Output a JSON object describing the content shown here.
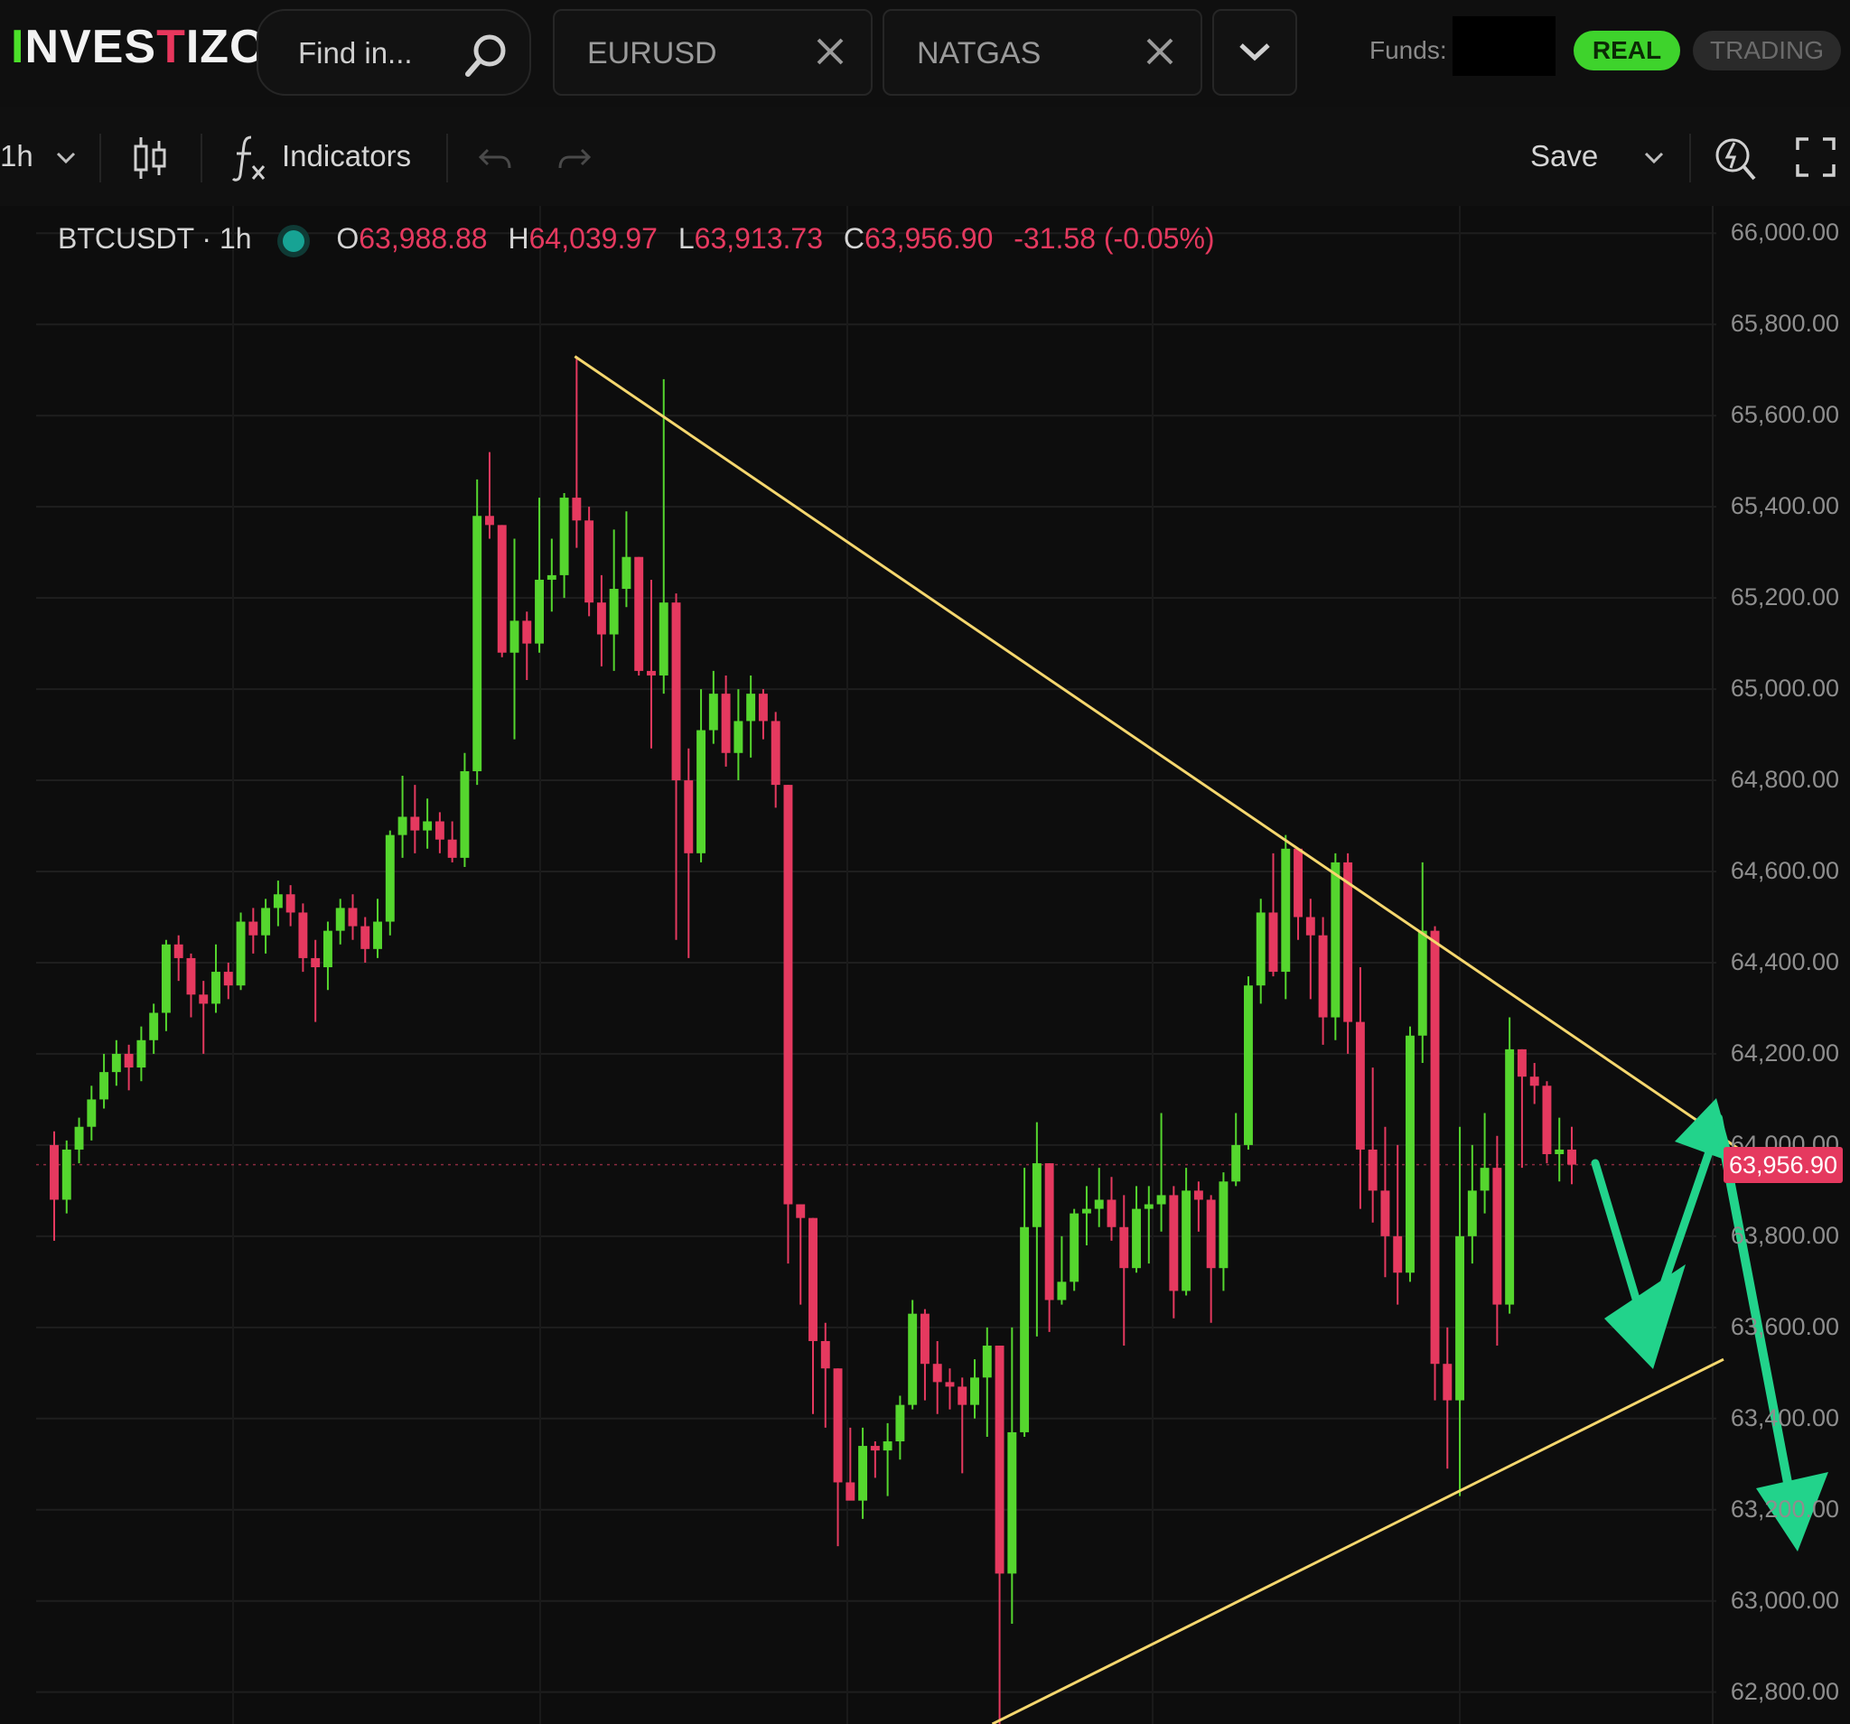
{
  "header": {
    "logo_text": "INVESTIZO",
    "search_placeholder": "Find in...",
    "tabs": [
      {
        "label": "EURUSD"
      },
      {
        "label": "NATGAS"
      }
    ],
    "funds_label": "Funds:",
    "real_label": "REAL",
    "trading_label": "TRADING"
  },
  "toolbar": {
    "interval": "1h",
    "indicators_label": "Indicators",
    "save_label": "Save"
  },
  "chart_info": {
    "symbol": "BTCUSDT · 1h",
    "open_key": "O",
    "open": "63,988.88",
    "high_key": "H",
    "high": "64,039.97",
    "low_key": "L",
    "low": "63,913.73",
    "close_key": "C",
    "close": "63,956.90",
    "change": "-31.58 (-0.05%)",
    "current_price_tag": "63,956.90"
  },
  "colors": {
    "up": "#55d62e",
    "down": "#e5395f",
    "trendline": "#f5d76e",
    "arrow": "#22d38b",
    "brand_green": "#3ed32c"
  },
  "chart_data": {
    "type": "candlestick",
    "interval": "1h",
    "y_axis_ticks": [
      "66,000.00",
      "65,800.00",
      "65,600.00",
      "65,400.00",
      "65,200.00",
      "65,000.00",
      "64,800.00",
      "64,600.00",
      "64,400.00",
      "64,200.00",
      "64,000.00",
      "63,800.00",
      "63,600.00",
      "63,400.00",
      "63,200.00",
      "63,000.00",
      "62,800.00"
    ],
    "ylim": [
      62730,
      66060
    ],
    "current_price": 63956.9,
    "candles": [
      [
        64000,
        63880,
        64030,
        63790
      ],
      [
        63880,
        63990,
        64010,
        63850
      ],
      [
        63990,
        64040,
        64060,
        63960
      ],
      [
        64040,
        64100,
        64130,
        64010
      ],
      [
        64100,
        64160,
        64200,
        64080
      ],
      [
        64160,
        64200,
        64230,
        64130
      ],
      [
        64200,
        64170,
        64220,
        64120
      ],
      [
        64170,
        64230,
        64260,
        64140
      ],
      [
        64230,
        64290,
        64310,
        64200
      ],
      [
        64290,
        64440,
        64450,
        64250
      ],
      [
        64440,
        64410,
        64460,
        64360
      ],
      [
        64410,
        64330,
        64420,
        64280
      ],
      [
        64330,
        64310,
        64360,
        64200
      ],
      [
        64310,
        64380,
        64440,
        64290
      ],
      [
        64380,
        64350,
        64400,
        64320
      ],
      [
        64350,
        64490,
        64510,
        64340
      ],
      [
        64490,
        64460,
        64520,
        64420
      ],
      [
        64460,
        64520,
        64540,
        64420
      ],
      [
        64520,
        64550,
        64580,
        64480
      ],
      [
        64550,
        64510,
        64570,
        64480
      ],
      [
        64510,
        64410,
        64530,
        64380
      ],
      [
        64410,
        64390,
        64450,
        64270
      ],
      [
        64390,
        64470,
        64490,
        64340
      ],
      [
        64470,
        64520,
        64540,
        64440
      ],
      [
        64520,
        64480,
        64550,
        64450
      ],
      [
        64480,
        64430,
        64500,
        64400
      ],
      [
        64430,
        64490,
        64540,
        64410
      ],
      [
        64490,
        64680,
        64690,
        64460
      ],
      [
        64680,
        64720,
        64810,
        64630
      ],
      [
        64720,
        64690,
        64790,
        64640
      ],
      [
        64690,
        64710,
        64760,
        64650
      ],
      [
        64710,
        64670,
        64730,
        64640
      ],
      [
        64670,
        64630,
        64710,
        64620
      ],
      [
        64630,
        64820,
        64860,
        64610
      ],
      [
        64820,
        65380,
        65460,
        64790
      ],
      [
        65380,
        65360,
        65520,
        65330
      ],
      [
        65360,
        65080,
        65360,
        65070
      ],
      [
        65080,
        65150,
        65330,
        64890
      ],
      [
        65150,
        65100,
        65170,
        65020
      ],
      [
        65100,
        65240,
        65420,
        65080
      ],
      [
        65240,
        65250,
        65330,
        65170
      ],
      [
        65250,
        65420,
        65430,
        65200
      ],
      [
        65420,
        65370,
        65730,
        65310
      ],
      [
        65370,
        65190,
        65400,
        65160
      ],
      [
        65190,
        65120,
        65250,
        65050
      ],
      [
        65120,
        65220,
        65350,
        65040
      ],
      [
        65220,
        65290,
        65390,
        65180
      ],
      [
        65290,
        65040,
        65290,
        65030
      ],
      [
        65040,
        65030,
        65240,
        64870
      ],
      [
        65030,
        65190,
        65680,
        64990
      ],
      [
        65190,
        64800,
        65210,
        64450
      ],
      [
        64800,
        64640,
        64870,
        64410
      ],
      [
        64640,
        64910,
        65000,
        64620
      ],
      [
        64910,
        64990,
        65040,
        64880
      ],
      [
        64990,
        64860,
        65030,
        64830
      ],
      [
        64860,
        64930,
        65000,
        64800
      ],
      [
        64930,
        64990,
        65030,
        64850
      ],
      [
        64990,
        64930,
        65000,
        64890
      ],
      [
        64930,
        64790,
        64950,
        64740
      ],
      [
        64790,
        63870,
        64790,
        63740
      ],
      [
        63870,
        63840,
        63870,
        63650
      ],
      [
        63840,
        63570,
        63840,
        63410
      ],
      [
        63570,
        63510,
        63610,
        63380
      ],
      [
        63510,
        63260,
        63510,
        63120
      ],
      [
        63260,
        63220,
        63380,
        63230
      ],
      [
        63220,
        63340,
        63380,
        63180
      ],
      [
        63340,
        63330,
        63350,
        63270
      ],
      [
        63330,
        63350,
        63390,
        63230
      ],
      [
        63350,
        63430,
        63450,
        63310
      ],
      [
        63430,
        63630,
        63660,
        63420
      ],
      [
        63630,
        63520,
        63640,
        63440
      ],
      [
        63520,
        63480,
        63570,
        63410
      ],
      [
        63480,
        63470,
        63510,
        63420
      ],
      [
        63470,
        63430,
        63490,
        63280
      ],
      [
        63430,
        63490,
        63530,
        63400
      ],
      [
        63490,
        63560,
        63600,
        63360
      ],
      [
        63560,
        63060,
        63560,
        62730
      ],
      [
        63060,
        63370,
        63600,
        62950
      ],
      [
        63370,
        63820,
        63950,
        63360
      ],
      [
        63820,
        63960,
        64050,
        63580
      ],
      [
        63960,
        63660,
        63960,
        63590
      ],
      [
        63660,
        63700,
        63800,
        63650
      ],
      [
        63700,
        63850,
        63860,
        63680
      ],
      [
        63850,
        63860,
        63910,
        63780
      ],
      [
        63860,
        63880,
        63950,
        63820
      ],
      [
        63880,
        63820,
        63930,
        63790
      ],
      [
        63820,
        63730,
        63890,
        63560
      ],
      [
        63730,
        63860,
        63910,
        63720
      ],
      [
        63860,
        63870,
        63910,
        63740
      ],
      [
        63870,
        63890,
        64070,
        63810
      ],
      [
        63890,
        63680,
        63910,
        63620
      ],
      [
        63680,
        63900,
        63950,
        63670
      ],
      [
        63900,
        63880,
        63920,
        63810
      ],
      [
        63880,
        63730,
        63890,
        63610
      ],
      [
        63730,
        63920,
        63940,
        63680
      ],
      [
        63920,
        64000,
        64070,
        63910
      ],
      [
        64000,
        64350,
        64370,
        63990
      ],
      [
        64350,
        64510,
        64540,
        64310
      ],
      [
        64510,
        64380,
        64640,
        64370
      ],
      [
        64380,
        64650,
        64680,
        64320
      ],
      [
        64650,
        64500,
        64650,
        64450
      ],
      [
        64500,
        64460,
        64540,
        64320
      ],
      [
        64460,
        64280,
        64500,
        64220
      ],
      [
        64280,
        64620,
        64640,
        64230
      ],
      [
        64620,
        64270,
        64640,
        64200
      ],
      [
        64270,
        63990,
        64390,
        63860
      ],
      [
        63990,
        63900,
        64170,
        63830
      ],
      [
        63900,
        63800,
        64040,
        63710
      ],
      [
        63800,
        63720,
        64000,
        63650
      ],
      [
        63720,
        64240,
        64260,
        63700
      ],
      [
        64240,
        64470,
        64620,
        64180
      ],
      [
        64470,
        63520,
        64480,
        63440
      ],
      [
        63520,
        63440,
        63600,
        63290
      ],
      [
        63440,
        63800,
        64040,
        63230
      ],
      [
        63800,
        63900,
        64000,
        63740
      ],
      [
        63900,
        63950,
        64070,
        63850
      ],
      [
        63950,
        63650,
        64020,
        63560
      ],
      [
        63650,
        64210,
        64280,
        63630
      ],
      [
        64210,
        64150,
        64210,
        63950
      ],
      [
        64150,
        64130,
        64180,
        64090
      ],
      [
        64130,
        63980,
        64140,
        63960
      ],
      [
        63980,
        63990,
        64060,
        63920
      ],
      [
        63990,
        63957,
        64040,
        63914
      ]
    ],
    "trendlines": [
      {
        "from": [
          "2-day high",
          65730
        ],
        "to": [
          "right edge",
          63990
        ]
      },
      {
        "from": [
          "low",
          62730
        ],
        "to": [
          "right edge",
          63530
        ]
      }
    ]
  }
}
